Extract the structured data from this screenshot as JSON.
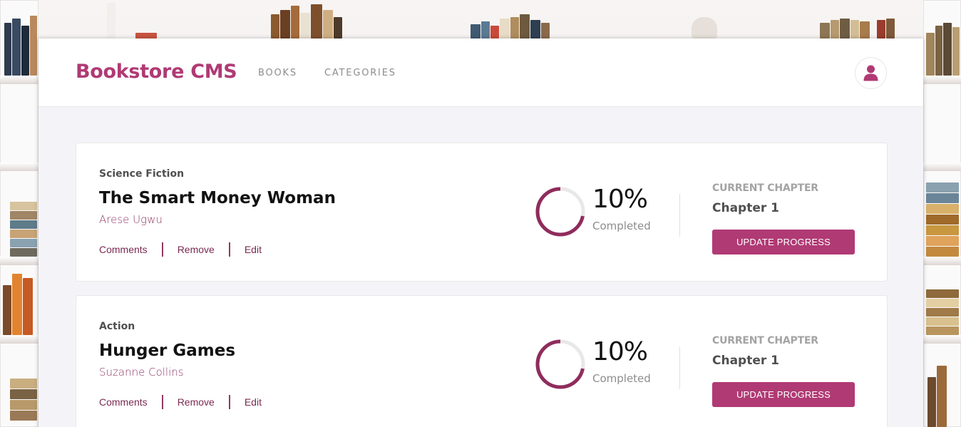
{
  "header": {
    "brand": "Bookstore CMS",
    "nav": [
      {
        "label": "BOOKS"
      },
      {
        "label": "CATEGORIES"
      }
    ],
    "avatar_icon": "user-icon"
  },
  "books": [
    {
      "genre": "Science Fiction",
      "title": "The Smart Money Woman",
      "author": "Arese Ugwu",
      "actions": {
        "comments": "Comments",
        "remove": "Remove",
        "edit": "Edit"
      },
      "progress_percent": 10,
      "progress_label": "10%",
      "completed_label": "Completed",
      "current_chapter_label": "CURRENT CHAPTER",
      "current_chapter": "Chapter 1",
      "update_button": "UPDATE PROGRESS"
    },
    {
      "genre": "Action",
      "title": "Hunger Games",
      "author": "Suzanne Collins",
      "actions": {
        "comments": "Comments",
        "remove": "Remove",
        "edit": "Edit"
      },
      "progress_percent": 10,
      "progress_label": "10%",
      "completed_label": "Completed",
      "current_chapter_label": "CURRENT CHAPTER",
      "current_chapter": "Chapter 1",
      "update_button": "UPDATE PROGRESS"
    }
  ],
  "colors": {
    "accent": "#b03a74",
    "ring_track": "#e8e8e8",
    "ring_fill": "#8f2c5c"
  }
}
